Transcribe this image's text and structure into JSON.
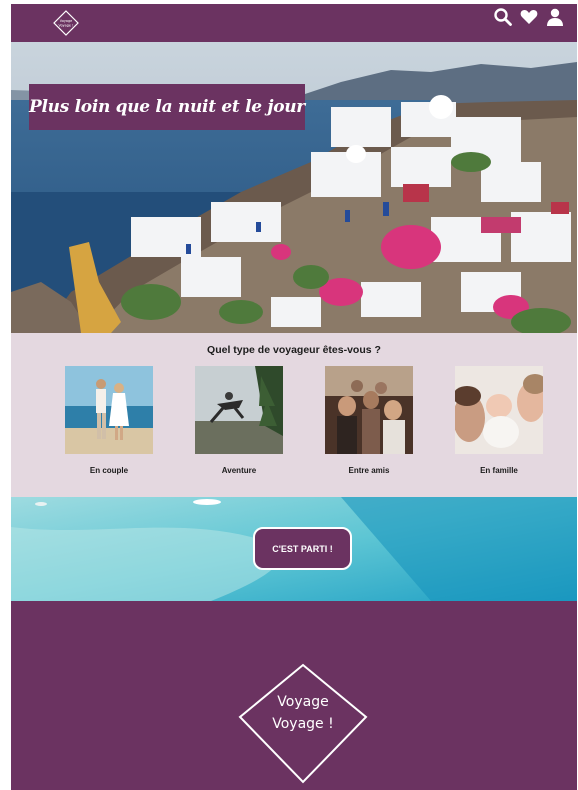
{
  "header": {
    "logo_text": "Voyage Voyage !",
    "icons": [
      "search-icon",
      "heart-icon",
      "user-icon"
    ]
  },
  "hero": {
    "title": "Plus loin que la nuit et le jour"
  },
  "traveler": {
    "title": "Quel type de voyageur êtes-vous ?",
    "cards": [
      {
        "label": "En couple"
      },
      {
        "label": "Aventure"
      },
      {
        "label": "Entre amis"
      },
      {
        "label": "En famille"
      }
    ]
  },
  "cta": {
    "label": "C'EST PARTI !"
  },
  "footer": {
    "logo_line1": "Voyage",
    "logo_line2": "Voyage !"
  },
  "colors": {
    "brand": "#6b3361",
    "section_bg": "#e4d8e0",
    "sea": "#3aa9c4"
  }
}
